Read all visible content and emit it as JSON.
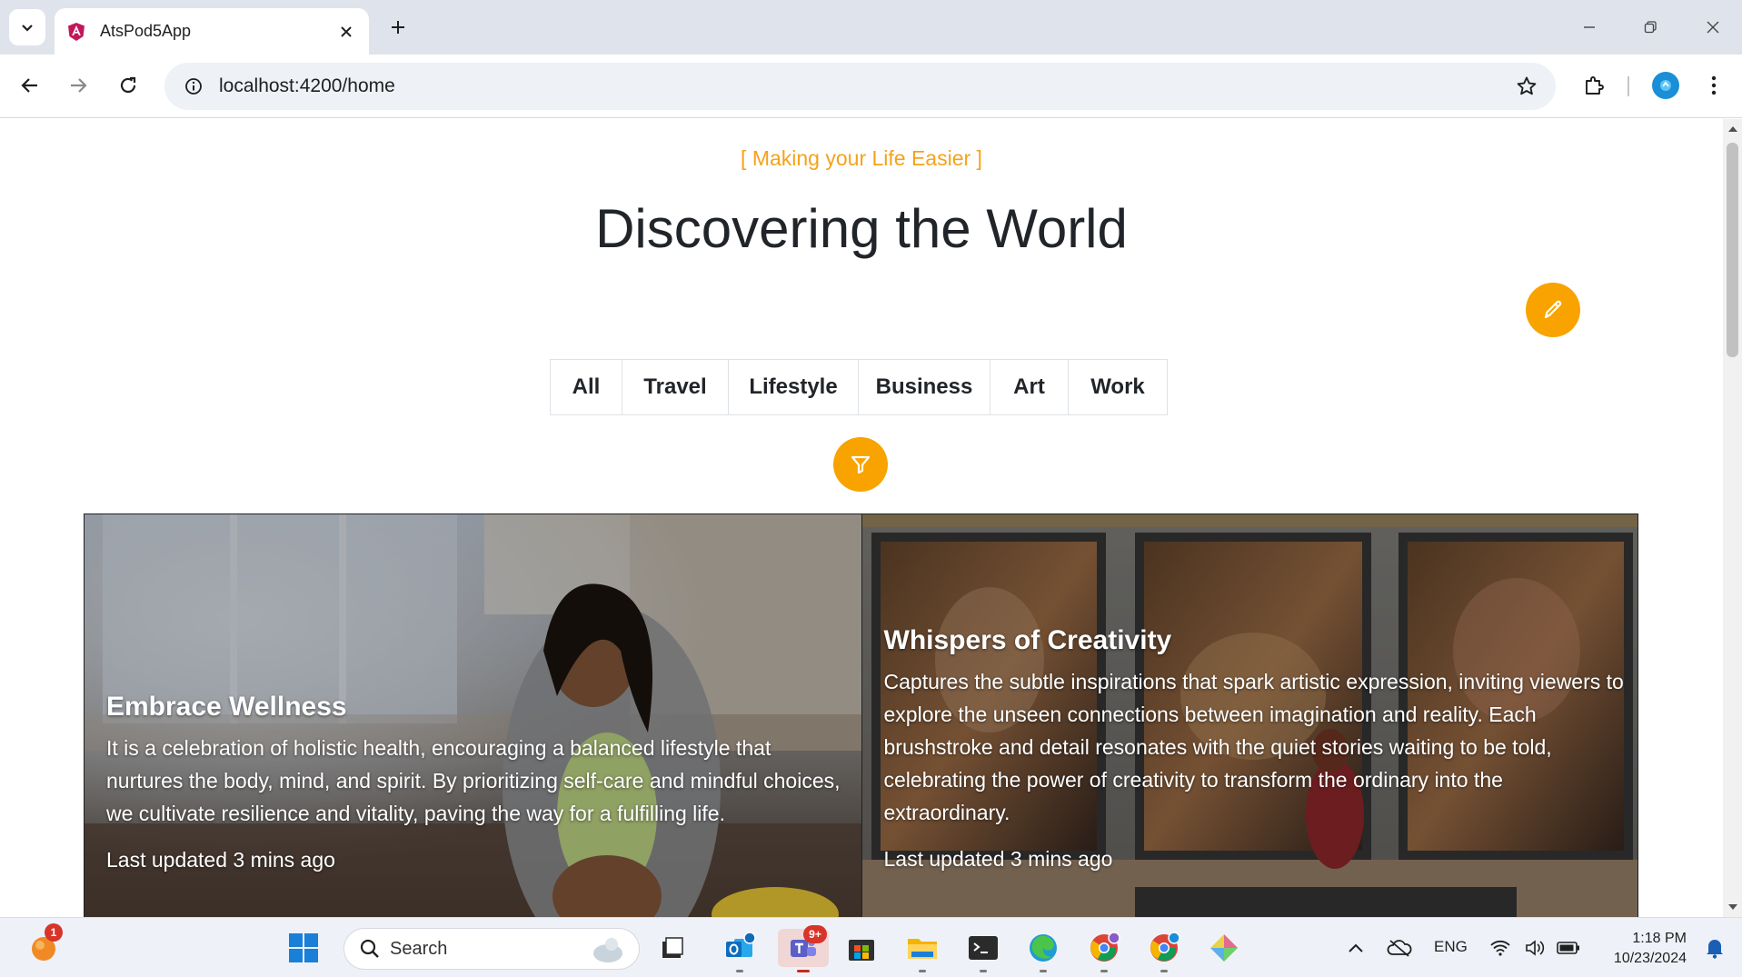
{
  "browser": {
    "tab_title": "AtsPod5App",
    "url": "localhost:4200/home"
  },
  "page": {
    "tagline": "[ Making your Life Easier ]",
    "title": "Discovering the World",
    "filters": [
      {
        "label": "All"
      },
      {
        "label": "Travel"
      },
      {
        "label": "Lifestyle"
      },
      {
        "label": "Business"
      },
      {
        "label": "Art"
      },
      {
        "label": "Work"
      }
    ],
    "cards": [
      {
        "title": "Embrace Wellness",
        "text": "It is a celebration of holistic health, encouraging a balanced lifestyle that nurtures the body, mind, and spirit. By prioritizing self-care and mindful choices, we cultivate resilience and vitality, paving the way for a fulfilling life.",
        "meta": "Last updated 3 mins ago"
      },
      {
        "title": "Whispers of Creativity",
        "text": "Captures the subtle inspirations that spark artistic expression, inviting viewers to explore the unseen connections between imagination and reality. Each brushstroke and detail resonates with the quiet stories waiting to be told, celebrating the power of creativity to transform the ordinary into the extraordinary.",
        "meta": "Last updated 3 mins ago"
      }
    ],
    "accent_color": "#f8a300"
  },
  "taskbar": {
    "search_label": "Search",
    "notification_badge": "1",
    "teams_badge": "9+",
    "language": "ENG",
    "time": "1:18 PM",
    "date": "10/23/2024"
  }
}
